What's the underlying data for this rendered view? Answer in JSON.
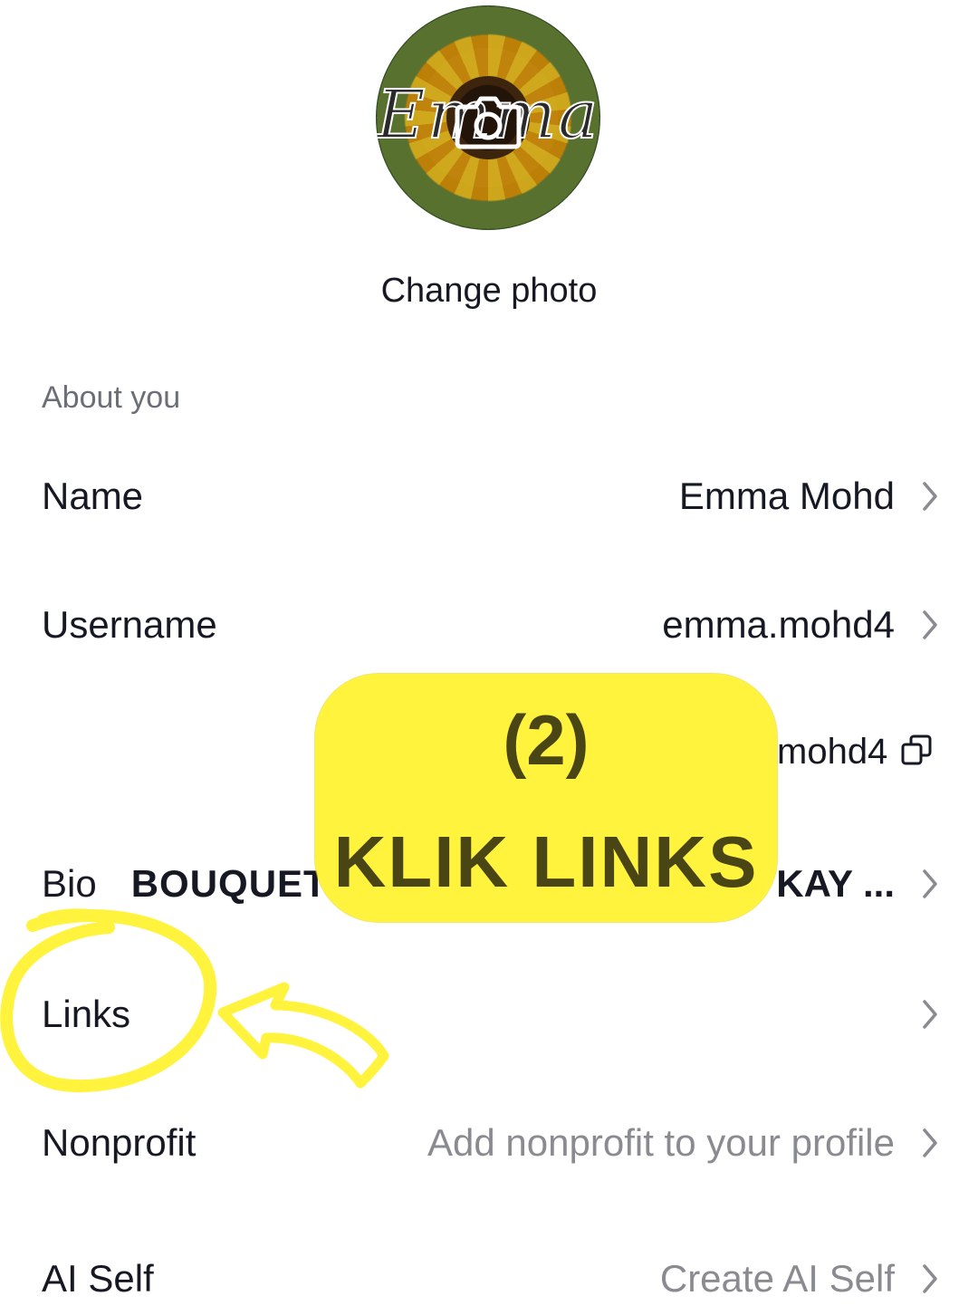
{
  "profile": {
    "photo_alt": "Profile photo",
    "avatar_script": "Emma",
    "change_photo": "Change photo"
  },
  "section": {
    "title": "About you"
  },
  "rows": {
    "name": {
      "label": "Name",
      "value": "Emma Mohd"
    },
    "username": {
      "label": "Username",
      "value": "emma.mohd4"
    },
    "tiktok_id": {
      "value": "mohd4"
    },
    "bio": {
      "label": "Bio",
      "value_start": "BOUQUET",
      "value_end": "KAY ..."
    },
    "links": {
      "label": "Links",
      "value": ""
    },
    "nonprofit": {
      "label": "Nonprofit",
      "value": "Add nonprofit to your profile"
    },
    "ai_self": {
      "label": "AI Self",
      "value": "Create AI Self"
    }
  },
  "overlay": {
    "step": "(2)",
    "instruction": "KLIK LINKS",
    "color": "#fff33d",
    "text_color": "#4a4514"
  },
  "icons": {
    "camera": "camera-icon",
    "chevron": "chevron-right-icon",
    "copy": "copy-icon"
  }
}
